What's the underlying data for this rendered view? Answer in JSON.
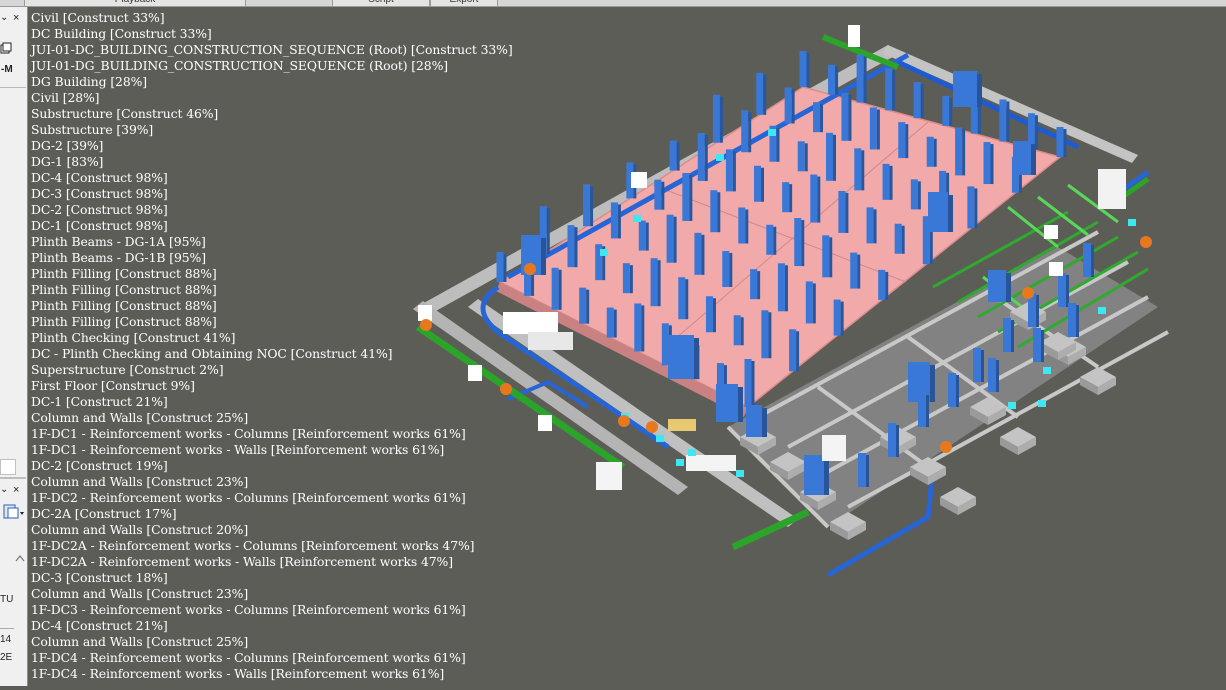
{
  "tabs": [
    "Playback",
    "Script",
    "Export"
  ],
  "side_panel": {
    "close_glyph": "×",
    "dropdown_glyph": "⌄",
    "label_m": "-M",
    "label_tu": "TU",
    "label_14": "14",
    "label_2e": "2E"
  },
  "task_labels": [
    "Civil [Construct 33%]",
    "DC Building [Construct 33%]",
    "JUI-01-DC_BUILDING_CONSTRUCTION_SEQUENCE (Root) [Construct 33%]",
    "JUI-01-DG_BUILDING_CONSTRUCTION_SEQUENCE (Root) [28%]",
    "DG Building [28%]",
    "Civil [28%]",
    "Substructure [Construct 46%]",
    "Substructure [39%]",
    "DG-2 [39%]",
    "DG-1 [83%]",
    "DC-4 [Construct 98%]",
    "DC-3 [Construct 98%]",
    "DC-2 [Construct 98%]",
    "DC-1 [Construct 98%]",
    "Plinth Beams - DG-1A [95%]",
    "Plinth Beams - DG-1B [95%]",
    "Plinth Filling [Construct 88%]",
    "Plinth Filling [Construct 88%]",
    "Plinth Filling [Construct 88%]",
    "Plinth Filling [Construct 88%]",
    "Plinth Checking [Construct 41%]",
    "DC - Plinth Checking and Obtaining NOC [Construct 41%]",
    "Superstructure [Construct 2%]",
    "First Floor [Construct 9%]",
    "DC-1 [Construct 21%]",
    "Column and Walls [Construct 25%]",
    "1F-DC1 - Reinforcement works - Columns [Reinforcement works 61%]",
    "1F-DC1 - Reinforcement works - Walls [Reinforcement works 61%]",
    "DC-2 [Construct 19%]",
    "Column and Walls [Construct 23%]",
    "1F-DC2 - Reinforcement works - Columns [Reinforcement works 61%]",
    "DC-2A [Construct 17%]",
    "Column and Walls [Construct 20%]",
    "1F-DC2A - Reinforcement works - Columns [Reinforcement works 47%]",
    "1F-DC2A - Reinforcement works - Walls [Reinforcement works 47%]",
    "DC-3 [Construct 18%]",
    "Column and Walls [Construct 23%]",
    "1F-DC3 - Reinforcement works - Columns [Reinforcement works 61%]",
    "DC-4 [Construct 21%]",
    "Column and Walls [Construct 25%]",
    "1F-DC4 - Reinforcement works - Columns [Reinforcement works 61%]",
    "1F-DC4 - Reinforcement works - Walls [Reinforcement works 61%]"
  ],
  "colors": {
    "background": "#5d5d58",
    "slab": "#f2aaaa",
    "column": "#3a78d8",
    "pipe_blue": "#2666d8",
    "pipe_green": "#2eaa2e",
    "frame": "#bcbcbc",
    "accent_cyan": "#3ee8f2",
    "accent_orange": "#e8781e",
    "overlay_text": "#ffffff"
  }
}
